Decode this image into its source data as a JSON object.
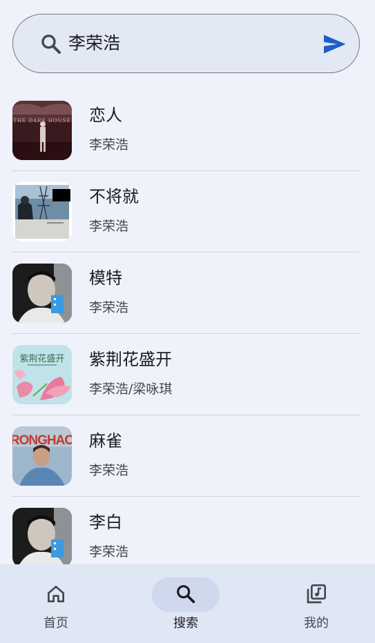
{
  "search": {
    "query": "李荣浩"
  },
  "songs": [
    {
      "title": "恋人",
      "artist": "李荣浩",
      "cover_text": "THE DARK HOUSE"
    },
    {
      "title": "不将就",
      "artist": "李荣浩"
    },
    {
      "title": "模特",
      "artist": "李荣浩"
    },
    {
      "title": "紫荆花盛开",
      "artist": "李荣浩/梁咏琪",
      "cover_text": "紫荆花盛开"
    },
    {
      "title": "麻雀",
      "artist": "李荣浩",
      "cover_text": "RONGHAO"
    },
    {
      "title": "李白",
      "artist": "李荣浩"
    }
  ],
  "nav": {
    "home": "首页",
    "search": "搜索",
    "mine": "我的",
    "active": "search"
  },
  "colors": {
    "accent": "#1e5cc8",
    "background": "#eff2fa",
    "nav_background": "#dfe6f4"
  }
}
